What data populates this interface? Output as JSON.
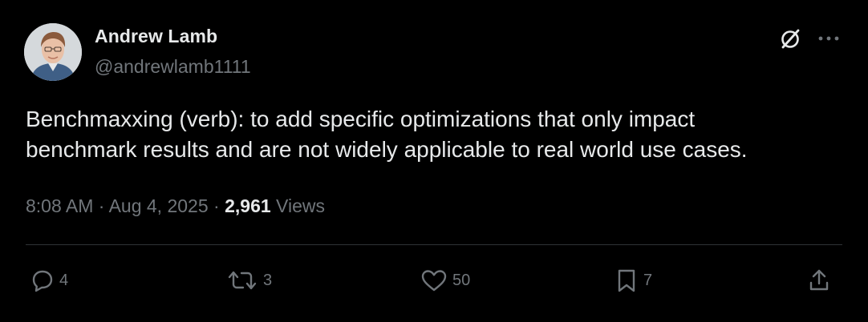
{
  "author": {
    "display_name": "Andrew Lamb",
    "handle": "@andrewlamb1111"
  },
  "tweet": {
    "text": "Benchmaxxing (verb): to add specific optimizations that only impact\nbenchmark results and are not widely applicable to real world use cases.",
    "time": "8:08 AM",
    "separator": "·",
    "date": "Aug 4, 2025",
    "views_count": "2,961",
    "views_label": "Views"
  },
  "actions": {
    "replies": "4",
    "reposts": "3",
    "likes": "50",
    "bookmarks": "7"
  },
  "icons": {
    "grok": "grok-icon",
    "more": "more-icon",
    "reply": "reply-icon",
    "repost": "repost-icon",
    "like": "heart-icon",
    "bookmark": "bookmark-icon",
    "share": "share-icon"
  },
  "colors": {
    "background": "#000000",
    "primary_text": "#e7e9ea",
    "secondary_text": "#71767b",
    "divider": "#2f3336"
  }
}
